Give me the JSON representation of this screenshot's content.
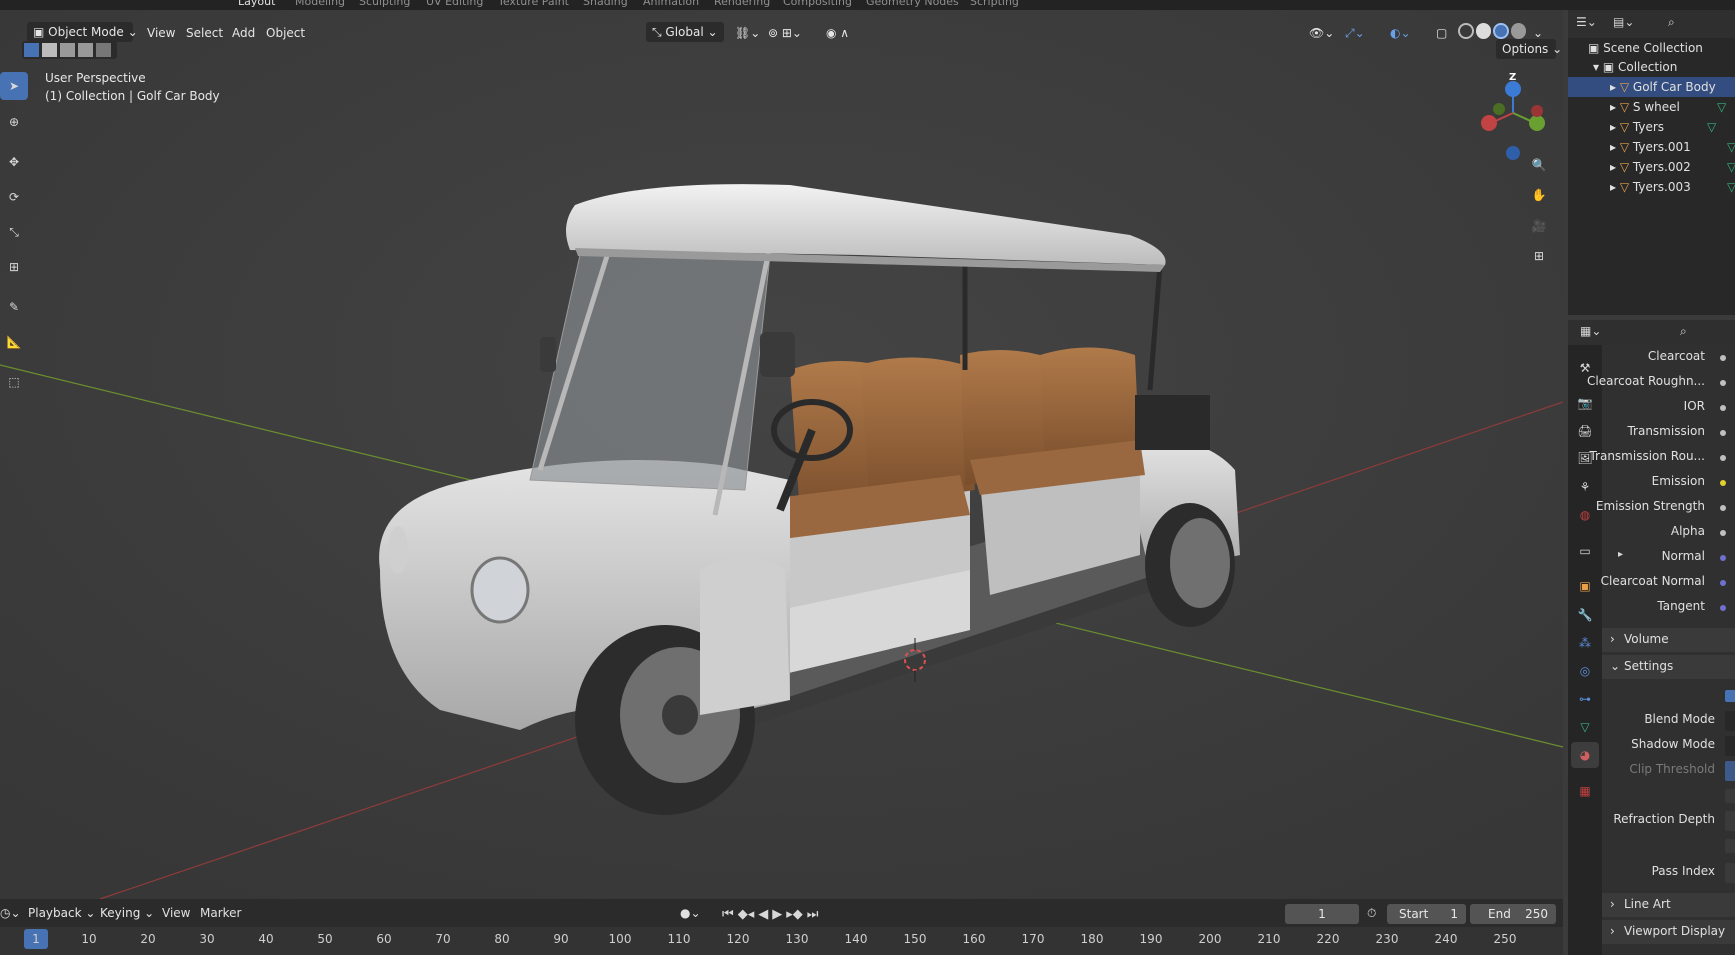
{
  "workspaces": [
    "Layout",
    "Modeling",
    "Sculpting",
    "UV Editing",
    "Texture Paint",
    "Shading",
    "Animation",
    "Rendering",
    "Compositing",
    "Geometry Nodes",
    "Scripting"
  ],
  "viewport": {
    "mode_label": "Object Mode",
    "menus": [
      "View",
      "Select",
      "Add",
      "Object"
    ],
    "transform_orientation": "Global",
    "options_label": "Options",
    "perspective_label": "User Perspective",
    "collection_label": "(1) Collection | Golf Car Body",
    "gizmo_axis_label": "Z"
  },
  "outliner": {
    "scene_collection": "Scene Collection",
    "collection": "Collection",
    "items": [
      {
        "name": "Golf Car Body",
        "selected": true
      },
      {
        "name": "S wheel",
        "selected": false
      },
      {
        "name": "Tyers",
        "selected": false
      },
      {
        "name": "Tyers.001",
        "selected": false
      },
      {
        "name": "Tyers.002",
        "selected": false
      },
      {
        "name": "Tyers.003",
        "selected": false
      }
    ]
  },
  "properties": {
    "rows": [
      {
        "label": "Clearcoat"
      },
      {
        "label": "Clearcoat Roughn..."
      },
      {
        "label": "IOR"
      },
      {
        "label": "Transmission"
      },
      {
        "label": "Transmission Rou..."
      },
      {
        "label": "Emission"
      },
      {
        "label": "Emission Strength"
      },
      {
        "label": "Alpha"
      },
      {
        "label": "Normal"
      },
      {
        "label": "Clearcoat Normal"
      },
      {
        "label": "Tangent"
      }
    ],
    "sections": {
      "volume": "Volume",
      "settings": "Settings",
      "line_art": "Line Art",
      "viewport_display": "Viewport Display"
    },
    "settings_rows": [
      {
        "label": "Blend Mode"
      },
      {
        "label": "Shadow Mode"
      },
      {
        "label": "Clip Threshold"
      },
      {
        "label": "Refraction Depth"
      },
      {
        "label": "Pass Index"
      }
    ]
  },
  "timeline": {
    "menus": [
      "Playback",
      "Keying",
      "View",
      "Marker"
    ],
    "current_frame": "1",
    "start_label": "Start",
    "start_value": "1",
    "end_label": "End",
    "end_value": "250",
    "ticks": [
      "1",
      "10",
      "20",
      "30",
      "40",
      "50",
      "60",
      "70",
      "80",
      "90",
      "100",
      "110",
      "120",
      "130",
      "140",
      "150",
      "160",
      "170",
      "180",
      "190",
      "200",
      "210",
      "220",
      "230",
      "240",
      "250"
    ]
  },
  "colors": {
    "accent": "#4772b3",
    "object_orange": "#e8a04a",
    "mesh_green": "#2fb57a",
    "axis_red": "#8f3b3b",
    "axis_green": "#6b8f2f"
  }
}
